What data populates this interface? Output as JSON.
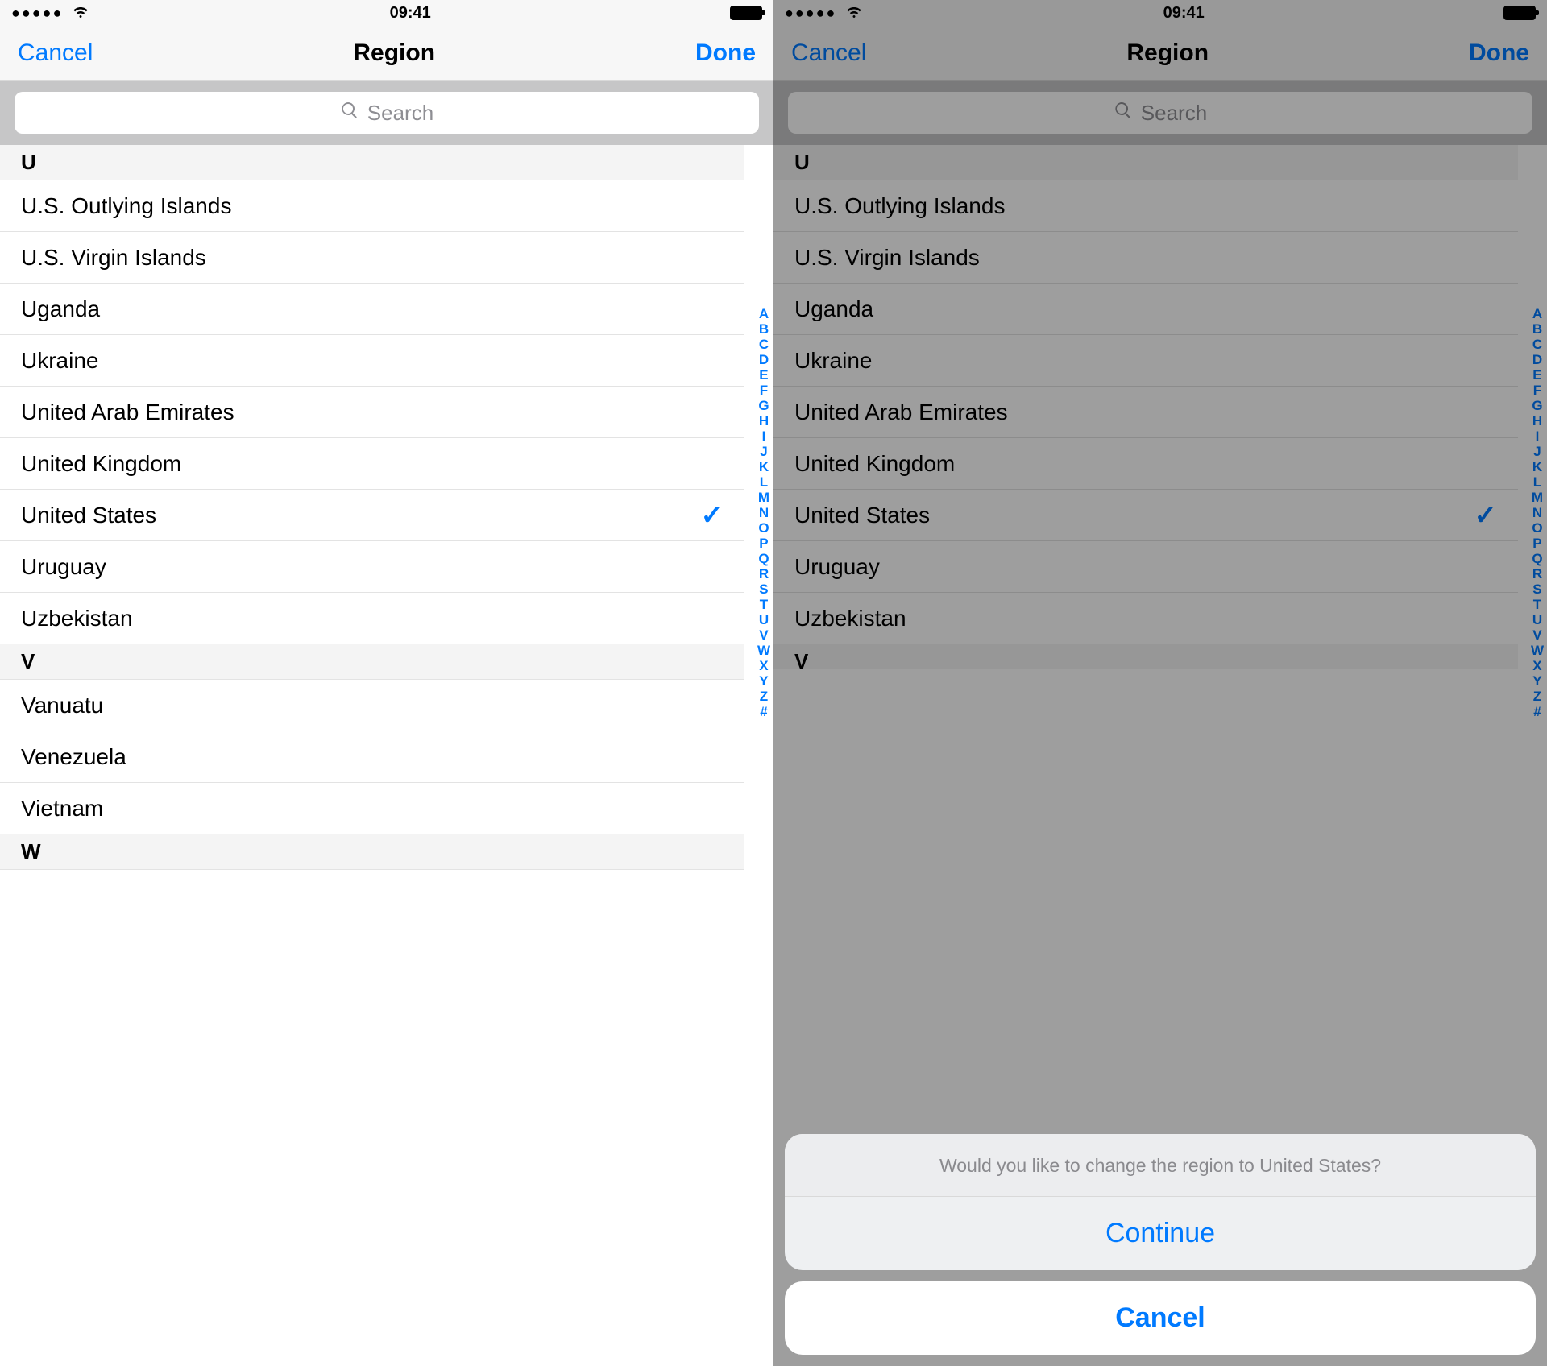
{
  "status": {
    "time": "09:41"
  },
  "nav": {
    "cancel": "Cancel",
    "title": "Region",
    "done": "Done"
  },
  "search": {
    "placeholder": "Search"
  },
  "sections": [
    {
      "letter": "U",
      "items": [
        {
          "name": "U.S. Outlying Islands",
          "selected": false
        },
        {
          "name": "U.S. Virgin Islands",
          "selected": false
        },
        {
          "name": "Uganda",
          "selected": false
        },
        {
          "name": "Ukraine",
          "selected": false
        },
        {
          "name": "United Arab Emirates",
          "selected": false
        },
        {
          "name": "United Kingdom",
          "selected": false
        },
        {
          "name": "United States",
          "selected": true
        },
        {
          "name": "Uruguay",
          "selected": false
        },
        {
          "name": "Uzbekistan",
          "selected": false
        }
      ]
    },
    {
      "letter": "V",
      "items": [
        {
          "name": "Vanuatu",
          "selected": false
        },
        {
          "name": "Venezuela",
          "selected": false
        },
        {
          "name": "Vietnam",
          "selected": false
        }
      ]
    },
    {
      "letter": "W",
      "items": []
    }
  ],
  "index_letters": [
    "A",
    "B",
    "C",
    "D",
    "E",
    "F",
    "G",
    "H",
    "I",
    "J",
    "K",
    "L",
    "M",
    "N",
    "O",
    "P",
    "Q",
    "R",
    "S",
    "T",
    "U",
    "V",
    "W",
    "X",
    "Y",
    "Z",
    "#"
  ],
  "alert": {
    "message": "Would you like to change the region to United States?",
    "continue": "Continue",
    "cancel": "Cancel"
  },
  "right_partial_section": "V"
}
